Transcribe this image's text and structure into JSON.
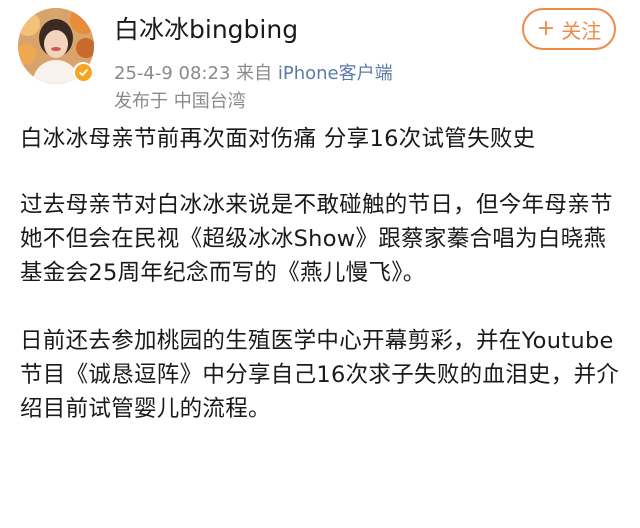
{
  "header": {
    "username": "白冰冰bingbing",
    "follow_label": "关注",
    "timestamp": "25-4-9 08:23",
    "source_prefix": "来自",
    "source_name": "iPhone客户端",
    "location": "发布于 中国台湾"
  },
  "article": {
    "title": "白冰冰母亲节前再次面对伤痛  分享16次试管失败史",
    "paragraph1": "过去母亲节对白冰冰来说是不敢碰触的节日，但今年母亲节她不但会在民视《超级冰冰Show》跟蔡家蓁合唱为白晓燕基金会25周年纪念而写的《燕儿慢飞》。",
    "paragraph2": "日前还去参加桃园的生殖医学中心开幕剪彩，并在Youtube节目《诚恳逗阵》中分享自己16次求子失败的血泪史，并介绍目前试管婴儿的流程。"
  },
  "colors": {
    "accent": "#f08a4b",
    "meta_gray": "#8a8a8a",
    "link_blue": "#5c7aa8",
    "verified": "#f5a623"
  },
  "icons": {
    "avatar": "avatar",
    "verified": "verified-badge-icon",
    "follow": "plus-icon"
  }
}
